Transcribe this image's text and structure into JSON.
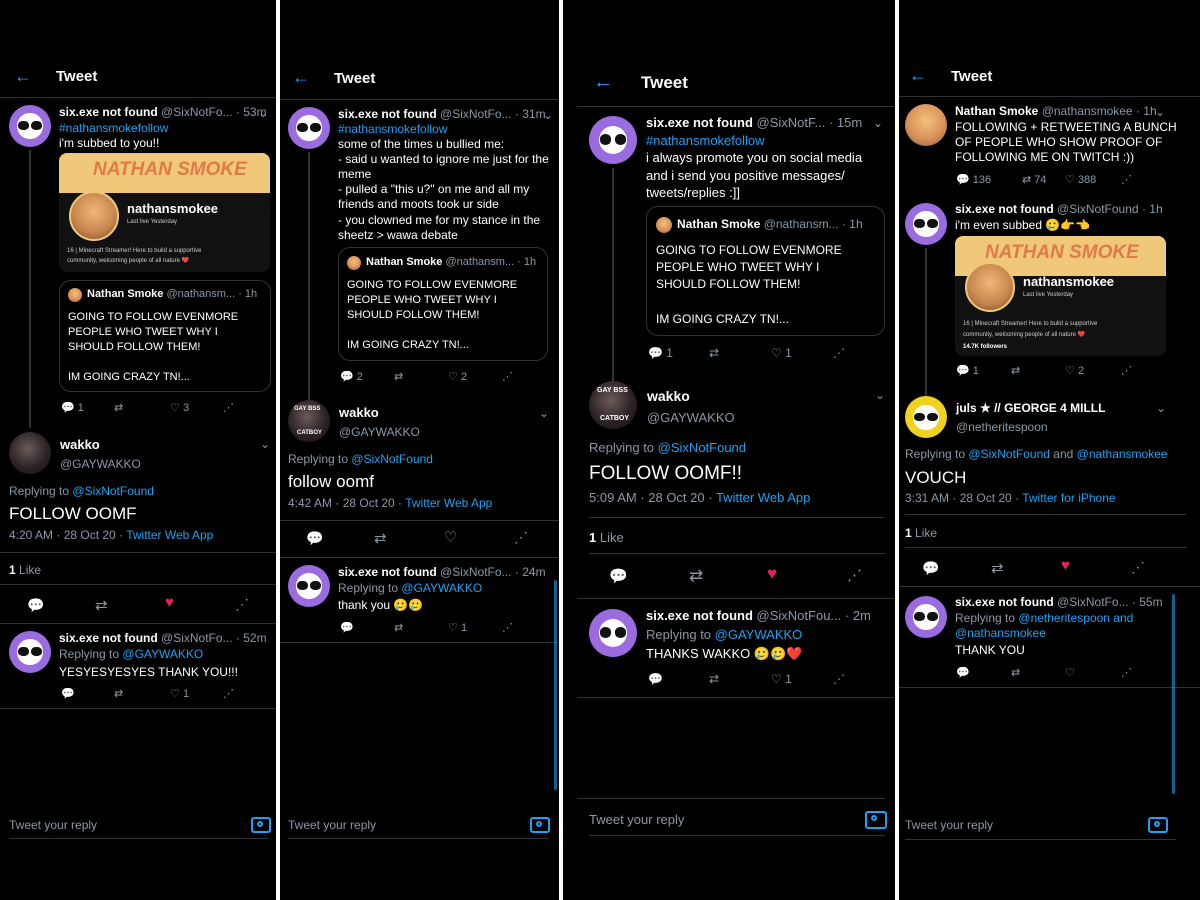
{
  "common": {
    "header_title": "Tweet",
    "reply_placeholder": "Tweet your reply",
    "six_name": "six.exe not found",
    "wakko_name": "wakko",
    "wakko_handle": "@GAYWAKKO",
    "ns_name": "Nathan Smoke",
    "hashtag": "#nathansmokefollow",
    "replying_to": "Replying to",
    "six_at": "@SixNotFound",
    "gaywakko_at": "@GAYWAKKO",
    "like_label": "Like",
    "ns_quote": [
      "GOING TO FOLLOW EVENMORE",
      "PEOPLE WHO TWEET WHY I",
      "SHOULD FOLLOW THEM!",
      "",
      "IM GOING CRAZY TN!..."
    ],
    "twitch_name": "nathansmokee",
    "twitch_live": "Last live Yesterday",
    "twitch_bio": [
      "16 | Minecraft Streamer! Here to build a supportive",
      "community, welcoming people of all nature ❤️"
    ],
    "twitch_followers": "14.7K followers",
    "banner_text": "NATHAN SMOKE"
  },
  "p1": {
    "six_handle": "@SixNotFo...",
    "t1_time": "· 53m",
    "t1_text": "i'm subbed to you!!",
    "quote_handle": "@nathansm...",
    "quote_time": "· 1h",
    "t1_stats": {
      "reply": "1",
      "like": "3"
    },
    "main_text": "FOLLOW OOMF",
    "main_time": "4:20 AM · 28 Oct 20 ·",
    "main_app": "Twitter Web App",
    "likes_count": "1",
    "r_time": "· 52m",
    "r_text": "YESYESYESYES THANK YOU!!!",
    "r_stats": {
      "like": "1"
    }
  },
  "p2": {
    "six_handle": "@SixNotFo...",
    "t1_time": "· 31m",
    "t1_lines": [
      "some of the times u bullied me:",
      "- said u wanted to ignore me just for the",
      "meme",
      "- pulled a \"this u?\" on me and all my",
      "friends and moots took ur side",
      "- you clowned me for my stance in the",
      "sheetz > wawa debate"
    ],
    "quote_handle": "@nathansm...",
    "quote_time": "· 1h",
    "t1_stats": {
      "reply": "2",
      "like": "2"
    },
    "main_text": "follow oomf",
    "main_time": "4:42 AM · 28 Oct 20 ·",
    "main_app": "Twitter Web App",
    "r_time": "· 24m",
    "r_text": "thank you 🥲🥲",
    "r_stats": {
      "like": "1"
    },
    "badge_top": "GAY BSS",
    "badge_bottom": "CATBOY"
  },
  "p3": {
    "six_handle": "@SixNotF...",
    "t1_time": "· 15m",
    "t1_lines": [
      "i always promote you on social media",
      "and i send you positive messages/",
      "tweets/replies :]]"
    ],
    "quote_handle": "@nathansm...",
    "quote_time": "· 1h",
    "t1_stats": {
      "reply": "1",
      "like": "1"
    },
    "main_text": "FOLLOW OOMF!!",
    "main_time": "5:09 AM · 28 Oct 20 ·",
    "main_app": "Twitter Web App",
    "likes_count": "1",
    "r_handle": "@SixNotFou...",
    "r_time": "· 2m",
    "r_text": "THANKS WAKKO 🥲🥲❤️",
    "r_stats": {
      "like": "1"
    },
    "badge_top": "GAY BSS",
    "badge_bottom": "CATBOY"
  },
  "p4": {
    "ns_handle": "@nathansmokee",
    "ns_time": "· 1h",
    "ns_lines": [
      "FOLLOWING + RETWEETING A BUNCH",
      "OF PEOPLE WHO SHOW PROOF OF",
      "FOLLOWING ME ON TWITCH :))"
    ],
    "ns_stats": {
      "reply": "136",
      "retweet": "74",
      "like": "388"
    },
    "six_handle": "@SixNotFound",
    "t2_time": "· 1h",
    "t2_text": "i'm even subbed 🥲👉👈",
    "t2_stats": {
      "reply": "1",
      "like": "2"
    },
    "juls_name": "juls ★ // GEORGE 4 MILLL",
    "juls_handle": "@netheritespoon",
    "main_reply_and": "and",
    "main_reply_ns": "@nathansmokee",
    "main_text": "VOUCH",
    "main_time": "3:31 AM · 28 Oct 20 ·",
    "main_app": "Twitter for iPhone",
    "likes_count": "1",
    "r_handle": "@SixNotFo...",
    "r_time": "· 55m",
    "r_reply_1": "@netheritespoon and",
    "r_reply_2": "@nathansmokee",
    "r_text": "THANK YOU"
  }
}
